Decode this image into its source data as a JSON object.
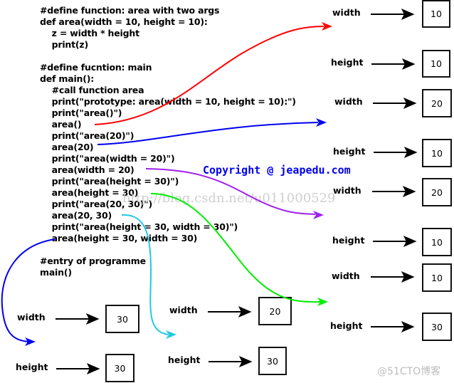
{
  "code_lines": [
    "#define function: area with two args",
    "def area(width = 10, height = 10):",
    "    z = width * height",
    "    print(z)",
    "",
    "#define fucntion: main",
    "def main():",
    "    #call function area",
    "    print(\"prototype: area(width = 10, height = 10):\")",
    "    print(\"area()\")",
    "    area()",
    "    print(\"area(20)\")",
    "    area(20)",
    "    print(\"area(width = 20)\")",
    "    area(width = 20)",
    "    print(\"area(height = 30)\")",
    "    area(height = 30)",
    "    print(\"area(20, 30)\")",
    "    area(20, 30)",
    "    print(\"area(height = 30, width = 30)\")",
    "    area(height = 30, width = 30)",
    "",
    "#entry of programme",
    "main()"
  ],
  "copyright": "Copyright @ jeapedu.com",
  "watermark": "http://blog.csdn.net/u011000529",
  "watermark_corner": "@51CTO博客",
  "call_results": [
    {
      "call": "area()",
      "color": "#ff0000",
      "params": [
        {
          "name": "width",
          "value": "10"
        },
        {
          "name": "height",
          "value": "10"
        }
      ]
    },
    {
      "call": "area(20)",
      "color": "#0000ee",
      "params": [
        {
          "name": "width",
          "value": "20"
        },
        {
          "name": "height",
          "value": "10"
        }
      ]
    },
    {
      "call": "area(width = 20)",
      "color": "#a020f0",
      "params": [
        {
          "name": "width",
          "value": "20"
        },
        {
          "name": "height",
          "value": "10"
        }
      ]
    },
    {
      "call": "area(height = 30)",
      "color": "#00ee00",
      "params": [
        {
          "name": "width",
          "value": "10"
        },
        {
          "name": "height",
          "value": "30"
        }
      ]
    },
    {
      "call": "area(20, 30)",
      "color": "#22c8e0",
      "params": [
        {
          "name": "width",
          "value": "20"
        },
        {
          "name": "height",
          "value": "30"
        }
      ]
    },
    {
      "call": "area(height = 30, width = 30)",
      "color": "#0000ee",
      "params": [
        {
          "name": "width",
          "value": "30"
        },
        {
          "name": "height",
          "value": "30"
        }
      ]
    }
  ]
}
